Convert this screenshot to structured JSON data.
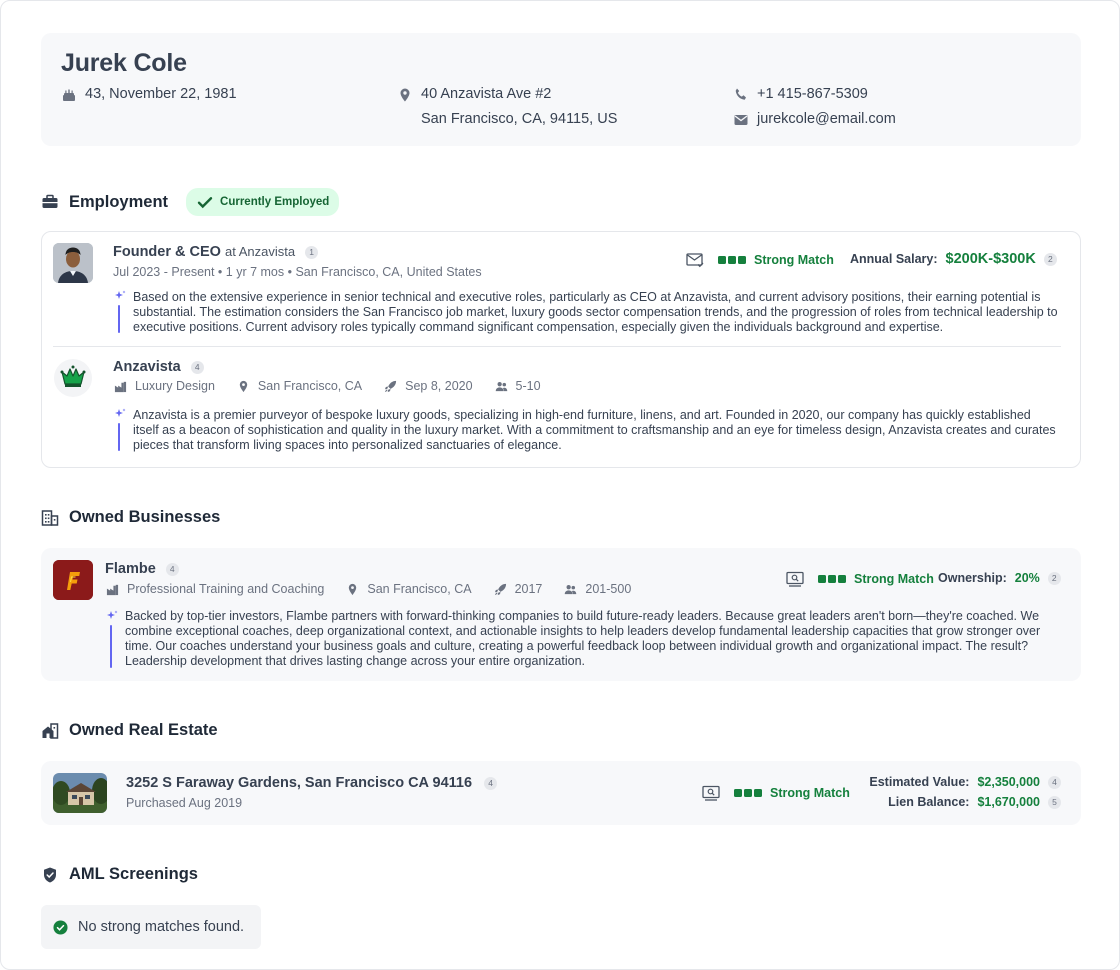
{
  "profile": {
    "name": "Jurek Cole",
    "age_dob": "43, November 22, 1981",
    "address_line1": "40 Anzavista Ave #2",
    "address_line2": "San Francisco, CA, 94115, US",
    "phone": "+1 415-867-5309",
    "email": "jurekcole@email.com"
  },
  "employment": {
    "title": "Employment",
    "status_badge": "Currently Employed",
    "role": {
      "position": "Founder & CEO",
      "at_label": "at Anzavista",
      "count": "1",
      "details": "Jul 2023 - Present • 1 yr 7 mos • San Francisco, CA, United States",
      "match_label": "Strong Match",
      "salary_label": "Annual Salary:",
      "salary_value": "$200K-$300K",
      "salary_count": "2",
      "description": "Based on the extensive experience in senior technical and executive roles, particularly as CEO at Anzavista, and current advisory positions, their earning potential is substantial. The estimation considers the San Francisco job market, luxury goods sector compensation trends, and the progression of roles from technical leadership to executive positions. Current advisory roles typically command significant compensation, especially given the individuals background and expertise."
    },
    "company": {
      "name": "Anzavista",
      "count": "4",
      "industry": "Luxury Design",
      "location": "San Francisco, CA",
      "founded": "Sep 8, 2020",
      "size": "5-10",
      "description": "Anzavista is a premier purveyor of bespoke luxury goods, specializing in high-end furniture, linens, and art. Founded in 2020, our company has quickly established itself as a beacon of sophistication and quality in the luxury market. With a commitment to craftsmanship and an eye for timeless design, Anzavista creates and curates pieces that transform living spaces into personalized sanctuaries of elegance."
    }
  },
  "businesses": {
    "title": "Owned Businesses",
    "item": {
      "name": "Flambe",
      "count": "4",
      "industry": "Professional Training and Coaching",
      "location": "San Francisco, CA",
      "founded": "2017",
      "size": "201-500",
      "match_label": "Strong Match",
      "ownership_label": "Ownership:",
      "ownership_value": "20%",
      "ownership_count": "2",
      "description": "Backed by top-tier investors, Flambe partners with forward-thinking companies to build future-ready leaders. Because great leaders aren't born—they're coached. We combine exceptional coaches, deep organizational context, and actionable insights to help leaders develop fundamental leadership capacities that grow stronger over time. Our coaches understand your business goals and culture, creating a powerful feedback loop between individual growth and organizational impact. The result? Leadership development that drives lasting change across your entire organization."
    }
  },
  "real_estate": {
    "title": "Owned Real Estate",
    "item": {
      "address": "3252 S Faraway Gardens, San Francisco CA 94116",
      "count": "4",
      "purchased": "Purchased Aug 2019",
      "match_label": "Strong Match",
      "value_label": "Estimated Value:",
      "value": "$2,350,000",
      "value_count": "4",
      "lien_label": "Lien Balance:",
      "lien": "$1,670,000",
      "lien_count": "5"
    }
  },
  "aml": {
    "title": "AML Screenings",
    "result": "No strong matches found."
  },
  "colors": {
    "accent_green": "#15803d",
    "badge_bg": "#dcfce7",
    "ai_bar": "#6366f1",
    "card_bg": "#f7f8fa"
  }
}
